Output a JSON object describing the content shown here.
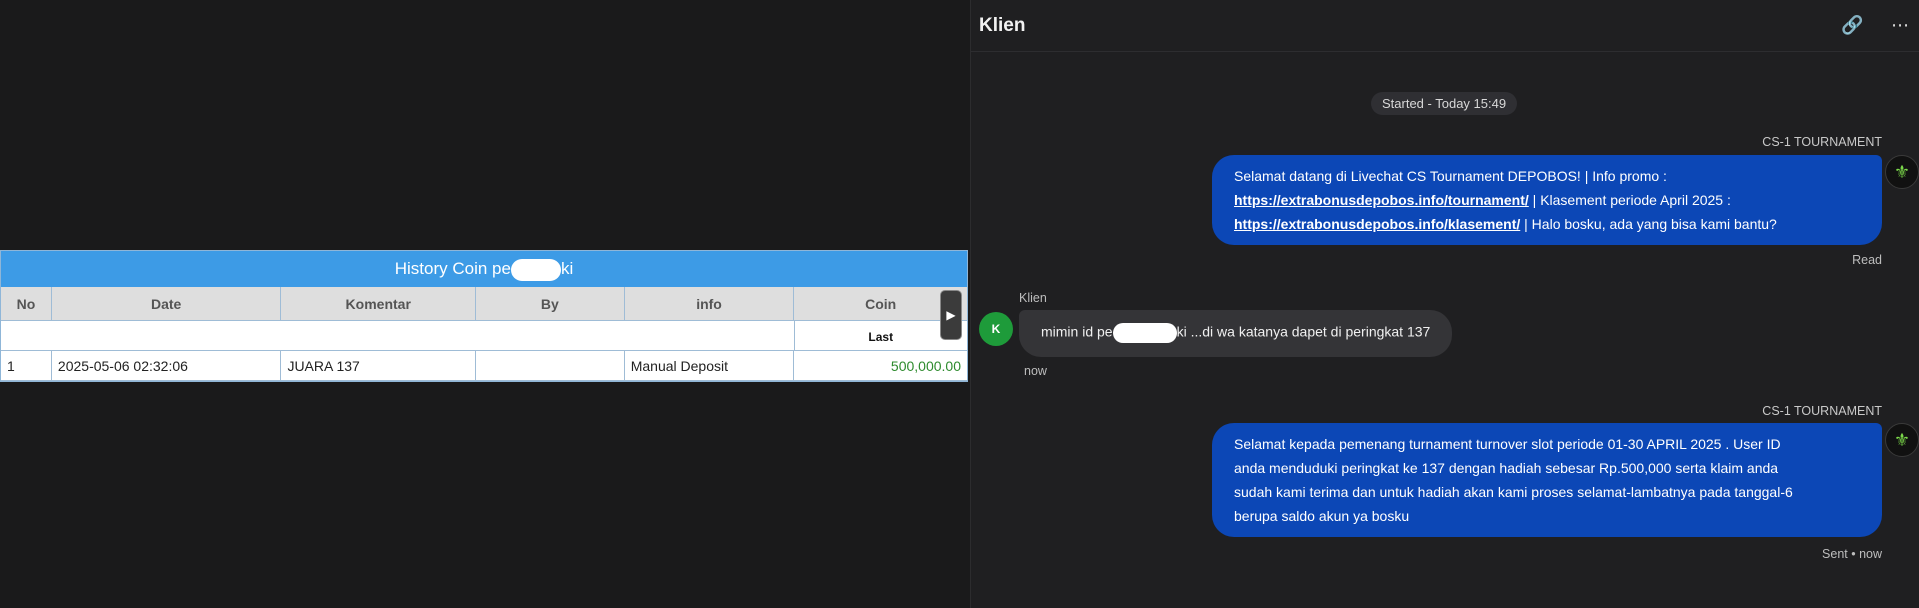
{
  "history": {
    "title_prefix": "History Coin pe",
    "title_suffix": "ki",
    "columns": [
      "No",
      "Date",
      "Komentar",
      "By",
      "info",
      "Coin"
    ],
    "sub_label": "Last",
    "rows": [
      {
        "no": "1",
        "date": "2025-05-06 02:32:06",
        "komentar": "JUARA 137",
        "by": "",
        "info": "Manual Deposit",
        "coin": "500,000.00"
      }
    ],
    "scroll_arrow": "▶"
  },
  "chat": {
    "title": "Klien",
    "header_icons": {
      "link": "link-icon",
      "more": "more-icon"
    },
    "link_glyph": "🔗",
    "more_glyph": "⋯",
    "started_label": "Started - Today 15:49",
    "messages": {
      "agent1": {
        "sender": "CS-1 TOURNAMENT",
        "line1": "Selamat datang di Livechat CS Tournament DEPOBOS! | Info promo :",
        "link1": "https://extrabonusdepobos.info/tournament/",
        "line2_rest": " | Klasement periode April 2025 :",
        "link2": "https://extrabonusdepobos.info/klasement/",
        "line3_rest": " | Halo bosku, ada yang bisa kami bantu?",
        "status": "Read"
      },
      "client": {
        "sender": "Klien",
        "avatar_letter": "K",
        "text_prefix": "mimin id pe",
        "text_suffix": "ki ...di wa katanya dapet di peringkat 137",
        "time": "now"
      },
      "agent2": {
        "sender": "CS-1 TOURNAMENT",
        "line1": "Selamat kepada pemenang turnament turnover slot periode 01-30 APRIL 2025 . User ID",
        "line2": "anda menduduki peringkat ke 137 dengan hadiah sebesar Rp.500,000 serta klaim anda",
        "line3": "sudah kami terima dan untuk hadiah akan kami proses selamat-lambatnya pada tanggal-6",
        "line4": "berupa saldo akun ya bosku",
        "status": "Sent • now"
      }
    },
    "colors": {
      "agent_bubble": "#0c47b6",
      "client_bubble": "#343437",
      "client_avatar": "#1e9b3a"
    }
  }
}
